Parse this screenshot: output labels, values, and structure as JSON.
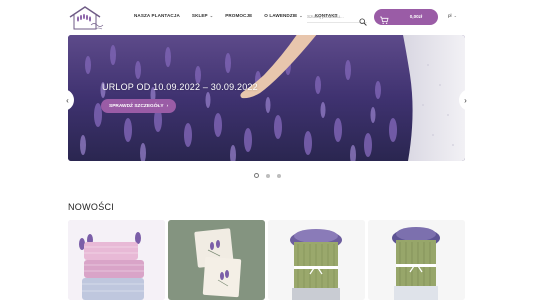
{
  "header": {
    "nav": [
      {
        "label": "NASZA PLANTACJA",
        "dropdown": false
      },
      {
        "label": "SKLEP",
        "dropdown": true
      },
      {
        "label": "PROMOCJE",
        "dropdown": false
      },
      {
        "label": "O LAWENDZIE",
        "dropdown": true
      },
      {
        "label": "KONTAKT",
        "dropdown": false
      }
    ],
    "search": {
      "placeholder": "Szukaj produktu..."
    },
    "cart": {
      "amount": "0,00zł"
    },
    "language": {
      "current": "pl"
    }
  },
  "hero": {
    "title": "URLOP OD 10.09.2022 – 30.09.2022",
    "button_label": "SPRAWDŹ SZCZEGÓŁY",
    "button_arrow": "›",
    "prev_arrow": "‹",
    "next_arrow": "›",
    "slide_count": 3,
    "active_slide": 1
  },
  "new_products": {
    "title": "NOWOŚCI",
    "items": [
      {
        "image": "lavender-pillows-image"
      },
      {
        "image": "lavender-sachets-image"
      },
      {
        "image": "lavender-bunch-image"
      },
      {
        "image": "lavender-bunch-image"
      }
    ]
  },
  "colors": {
    "accent": "#9a5ca6",
    "hero_bg": "#4b3a7a",
    "card_bg": "#f4f4f4"
  }
}
